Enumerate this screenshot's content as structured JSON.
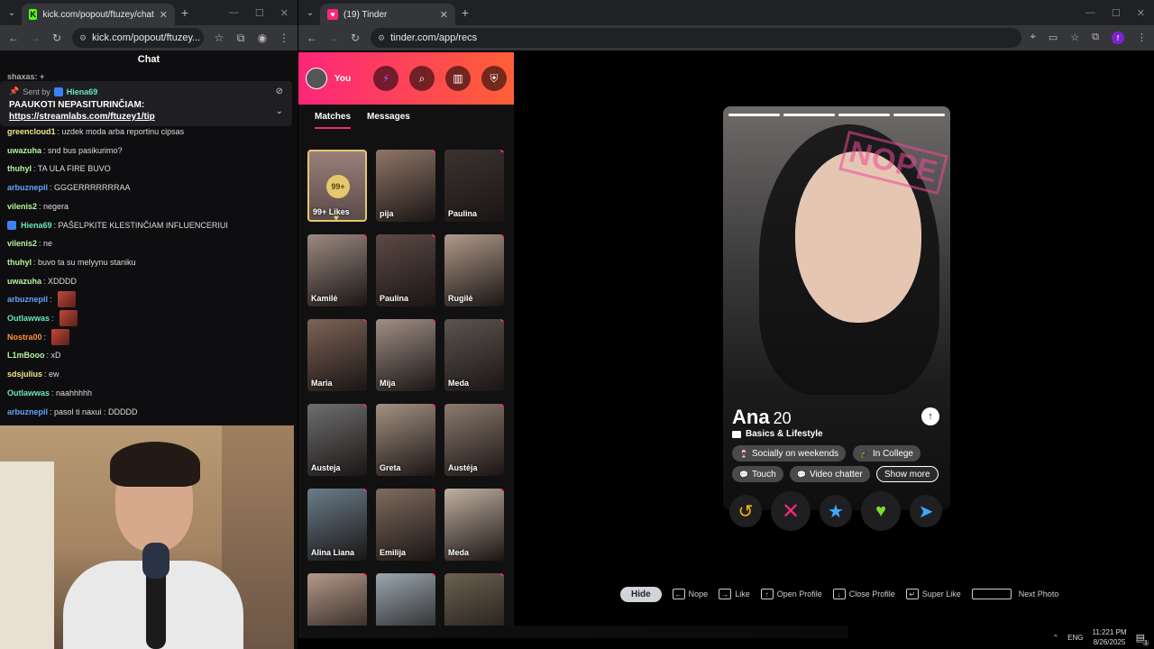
{
  "left_browser": {
    "tab_title": "kick.com/popout/ftuzey/chat",
    "url": "kick.com/popout/ftuzey...",
    "chat_title": "Chat",
    "cut_line": "shaxas: +",
    "pinned": {
      "sent_by_label": "Sent by",
      "sent_by_user": "Hiena69",
      "text": "PAAUKOTI NEPASITURINČIAM:",
      "link": "https://streamlabs.com/ftuzey1/tip"
    },
    "messages": [
      {
        "user": "greencloud1",
        "color": "#f0e68c",
        "text": ": uzdek moda arba reportinu cipsas",
        "emote": false,
        "badge": false
      },
      {
        "user": "uwazuha",
        "color": "#b5f59a",
        "text": ": snd bus pasikurimo?",
        "emote": false,
        "badge": false
      },
      {
        "user": "thuhyl",
        "color": "#b5f59a",
        "text": ": TA ULA FIRE BUVO",
        "emote": false,
        "badge": false
      },
      {
        "user": "arbuznepil",
        "color": "#60a5fa",
        "text": ": GGGERRRRRRRAA",
        "emote": false,
        "badge": false
      },
      {
        "user": "vilenis2",
        "color": "#b5f59a",
        "text": ": negera",
        "emote": false,
        "badge": false
      },
      {
        "user": "Hiena69",
        "color": "#6ee7b7",
        "text": ": PAŠELPKITE KLESTINČIAM INFLUENCERIUI",
        "emote": false,
        "badge": true
      },
      {
        "user": "vilenis2",
        "color": "#b5f59a",
        "text": ": ne",
        "emote": false,
        "badge": false
      },
      {
        "user": "thuhyl",
        "color": "#b5f59a",
        "text": ": buvo ta su melyynu staniku",
        "emote": false,
        "badge": false
      },
      {
        "user": "uwazuha",
        "color": "#b5f59a",
        "text": ": XDDDD",
        "emote": false,
        "badge": false
      },
      {
        "user": "arbuznepil",
        "color": "#60a5fa",
        "text": ":",
        "emote": true,
        "badge": false
      },
      {
        "user": "Outlawwas",
        "color": "#6ee7b7",
        "text": ":",
        "emote": true,
        "badge": false
      },
      {
        "user": "Nostra00",
        "color": "#fb923c",
        "text": ":",
        "emote": true,
        "badge": false
      },
      {
        "user": "L1mBooo",
        "color": "#b5f59a",
        "text": ": xD",
        "emote": false,
        "badge": false
      },
      {
        "user": "sdsjulius",
        "color": "#f0e68c",
        "text": ": ew",
        "emote": false,
        "badge": false
      },
      {
        "user": "Outlawwas",
        "color": "#6ee7b7",
        "text": ": naahhhhh",
        "emote": false,
        "badge": false
      },
      {
        "user": "arbuznepil",
        "color": "#60a5fa",
        "text": ": pasol ti naxui : DDDDD",
        "emote": false,
        "badge": false
      }
    ]
  },
  "right_browser": {
    "tab_title": "(19) Tinder",
    "url": "tinder.com/app/recs",
    "profile_initial": "f"
  },
  "tinder": {
    "you_label": "You",
    "tabs": [
      "Matches",
      "Messages"
    ],
    "likes_count": "99+",
    "likes_label": "99+ Likes",
    "matches": [
      "pija",
      "Paulina",
      "Kamilė",
      "Paulina",
      "Rugilė",
      "Maria",
      "Mija",
      "Meda",
      "Austeja",
      "Greta",
      "Austėja",
      "Alina Liana",
      "Emilija",
      "Meda",
      "",
      "",
      ""
    ],
    "profile": {
      "name": "Ana",
      "age": "20",
      "basics_label": "Basics & Lifestyle",
      "chips": [
        "Socially on weekends",
        "In College",
        "Touch",
        "Video chatter"
      ],
      "show_more": "Show more",
      "stamp": "NOPE"
    },
    "shortcuts": {
      "hide": "Hide",
      "items": [
        "Nope",
        "Like",
        "Open Profile",
        "Close Profile",
        "Super Like"
      ],
      "next_photo": "Next Photo"
    }
  },
  "taskbar": {
    "lang": "ENG",
    "time": "11:221 PM",
    "date": "8/26/2025",
    "notif_count": "1"
  },
  "colors": {
    "tinder_gradient_start": "#fd267a",
    "tinder_gradient_end": "#ff6036",
    "likes_gold": "#e5c86c"
  }
}
